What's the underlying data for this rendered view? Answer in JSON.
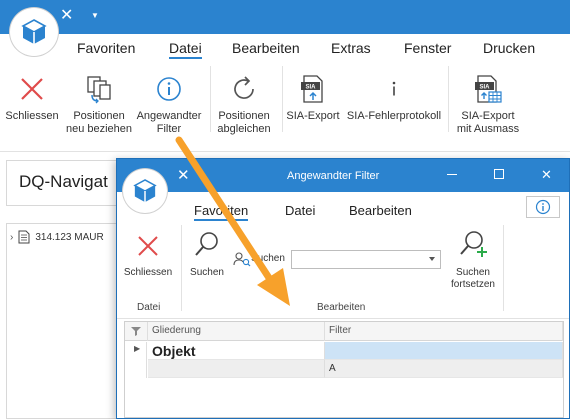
{
  "main_window": {
    "menu": [
      {
        "label": "Favoriten",
        "active": false
      },
      {
        "label": "Datei",
        "active": true
      },
      {
        "label": "Bearbeiten",
        "active": false
      },
      {
        "label": "Extras",
        "active": false
      },
      {
        "label": "Fenster",
        "active": false
      },
      {
        "label": "Drucken",
        "active": false
      }
    ],
    "ribbon": [
      {
        "label": "Schliessen",
        "icon": "close-icon"
      },
      {
        "label_line1": "Positionen",
        "label_line2": "neu beziehen",
        "icon": "copy-refresh-icon"
      },
      {
        "label_line1": "Angewandter",
        "label_line2": "Filter",
        "icon": "info-icon"
      },
      {
        "label_line1": "Positionen",
        "label_line2": "abgleichen",
        "icon": "refresh-icon"
      },
      {
        "label": "SIA-Export",
        "icon": "sia-export-icon"
      },
      {
        "label": "SIA-Fehlerprotokoll",
        "icon": "info-small-icon"
      },
      {
        "label_line1": "SIA-Export",
        "label_line2": "mit Ausmass",
        "icon": "sia-export-table-icon"
      }
    ],
    "navigator": {
      "title": "DQ-Navigat",
      "tree_item": "314.123 MAUR"
    }
  },
  "dialog": {
    "title": "Angewandter Filter",
    "menu": [
      {
        "label": "Favoriten",
        "active": true
      },
      {
        "label": "Datei",
        "active": false
      },
      {
        "label": "Bearbeiten",
        "active": false
      }
    ],
    "ribbon": {
      "close_label": "Schliessen",
      "search_label": "Suchen",
      "search_field_label": "Suchen",
      "search_value": "",
      "continue_line1": "Suchen",
      "continue_line2": "fortsetzen",
      "group_datei": "Datei",
      "group_bearbeiten": "Bearbeiten"
    },
    "grid": {
      "columns": [
        "Gliederung",
        "Filter"
      ],
      "rows": [
        {
          "gliederung": "Objekt",
          "filter": ""
        },
        {
          "gliederung": "",
          "filter": "A"
        }
      ]
    }
  },
  "colors": {
    "titlebar": "#2b83cf",
    "close_red": "#e04b4b",
    "accent_blue": "#2b83cf",
    "arrow_orange": "#f7a12b",
    "selected_row": "#cde3f6"
  }
}
